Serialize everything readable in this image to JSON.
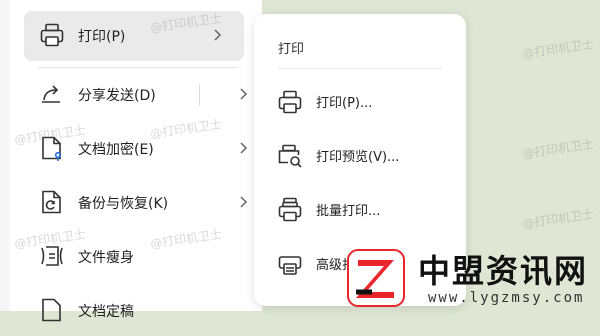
{
  "left_menu": {
    "items": [
      {
        "label": "打印(P)",
        "icon": "printer-icon",
        "has_arrow": true,
        "selected": true
      },
      {
        "label": "分享发送(D)",
        "icon": "share-icon",
        "has_arrow": true
      },
      {
        "label": "文档加密(E)",
        "icon": "document-lock-icon",
        "has_arrow": true
      },
      {
        "label": "备份与恢复(K)",
        "icon": "backup-restore-icon",
        "has_arrow": true
      },
      {
        "label": "文件瘦身",
        "icon": "file-slim-icon",
        "has_arrow": false
      },
      {
        "label": "文档定稿",
        "icon": "document-finalize-icon",
        "has_arrow": false
      }
    ]
  },
  "submenu": {
    "title": "打印",
    "items": [
      {
        "label": "打印(P)...",
        "icon": "printer-icon"
      },
      {
        "label": "打印预览(V)...",
        "icon": "print-preview-icon"
      },
      {
        "label": "批量打印...",
        "icon": "batch-print-icon"
      },
      {
        "label": "高级打",
        "icon": "advanced-print-icon"
      }
    ]
  },
  "watermark": {
    "text": "@打印机卫士"
  },
  "logo": {
    "name": "中盟资讯网",
    "url": "www.lygzmsy.com",
    "accent_color": "#e8262c"
  }
}
